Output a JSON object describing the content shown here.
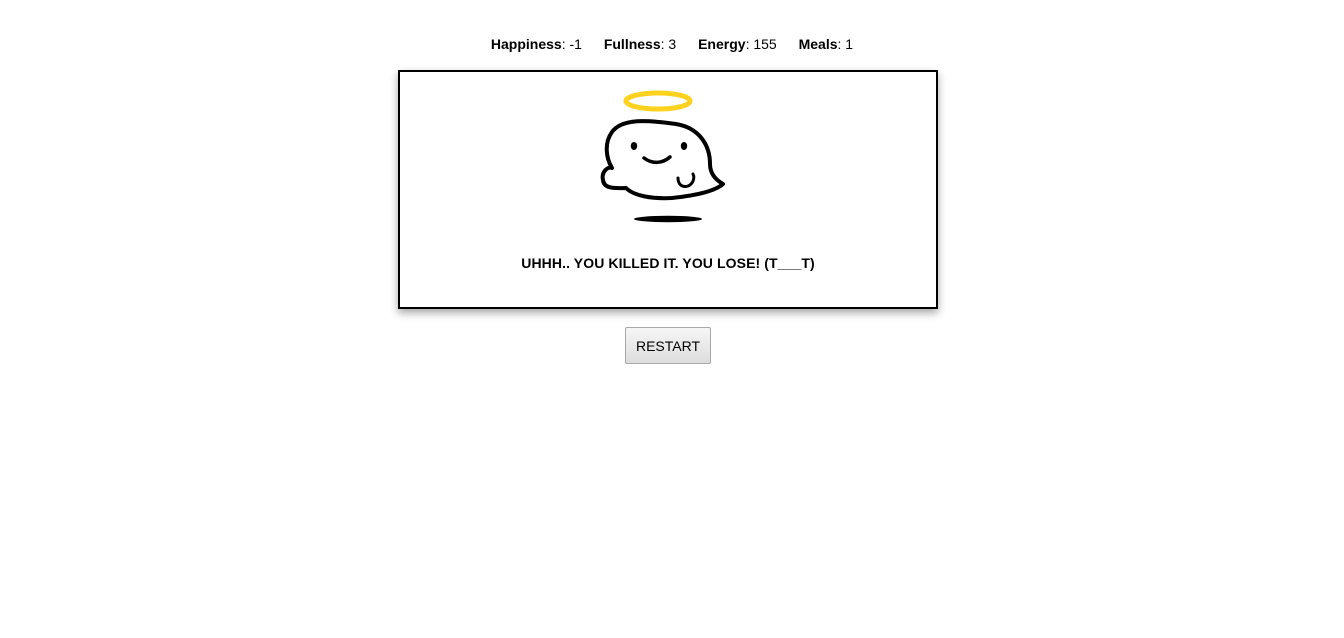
{
  "stats": [
    {
      "label": "Happiness",
      "value": ": -1"
    },
    {
      "label": "Fullness",
      "value": ": 3"
    },
    {
      "label": "Energy",
      "value": ": 155"
    },
    {
      "label": "Meals",
      "value": ": 1"
    }
  ],
  "pet": {
    "icon": "angel-ghost-icon",
    "halo_color": "#FFD21F"
  },
  "message": "UHHH.. YOU KILLED IT. YOU LOSE! (T___T)",
  "restart_label": "RESTART"
}
